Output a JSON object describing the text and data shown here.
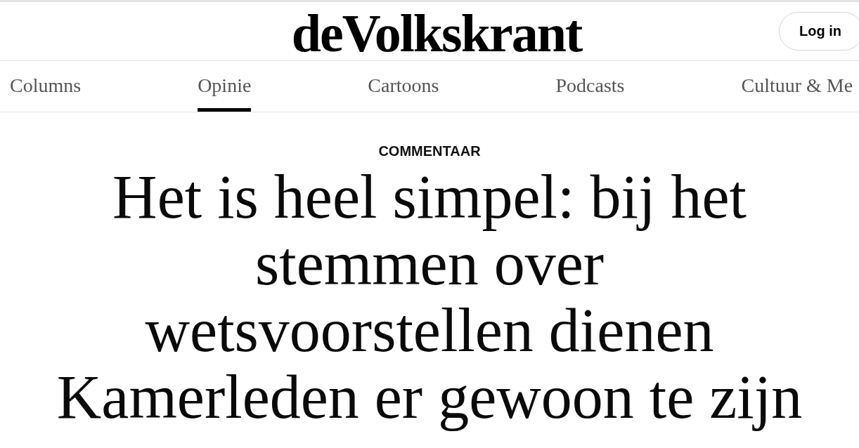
{
  "header": {
    "logo": "deVolkskrant",
    "login_button": "Log in"
  },
  "nav": [
    {
      "label": "Columns",
      "selected": false
    },
    {
      "label": "Opinie",
      "selected": true
    },
    {
      "label": "Cartoons",
      "selected": false
    },
    {
      "label": "Podcasts",
      "selected": false
    },
    {
      "label": "Cultuur & Me",
      "selected": false
    }
  ],
  "article": {
    "category": "COMMENTAAR",
    "headline": "Het is heel simpel: bij het stemmen over wetsvoorstellen dienen Kamerleden er gewoon te zijn"
  }
}
